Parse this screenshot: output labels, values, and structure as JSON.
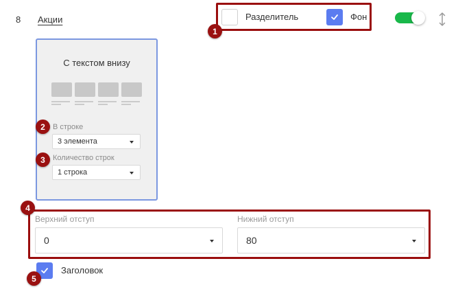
{
  "row": {
    "number": "8",
    "section_title": "Акции"
  },
  "options": {
    "divider": {
      "label": "Разделитель",
      "checked": false
    },
    "background": {
      "label": "Фон",
      "checked": true
    },
    "enabled_toggle": {
      "on": true
    }
  },
  "template_card": {
    "title": "С текстом внизу",
    "per_row": {
      "label": "В строке",
      "value": "3 элемента"
    },
    "rows_count": {
      "label": "Количество строк",
      "value": "1 строка"
    }
  },
  "padding": {
    "top": {
      "label": "Верхний отступ",
      "value": "0"
    },
    "bottom": {
      "label": "Нижний отступ",
      "value": "80"
    }
  },
  "heading_option": {
    "label": "Заголовок",
    "checked": true
  },
  "markers": [
    "1",
    "2",
    "3",
    "4",
    "5"
  ],
  "colors": {
    "accent": "#5b7cf0",
    "toggle_on": "#19b84a",
    "highlight": "#9a0d0d",
    "card_border": "#7b97e0"
  }
}
